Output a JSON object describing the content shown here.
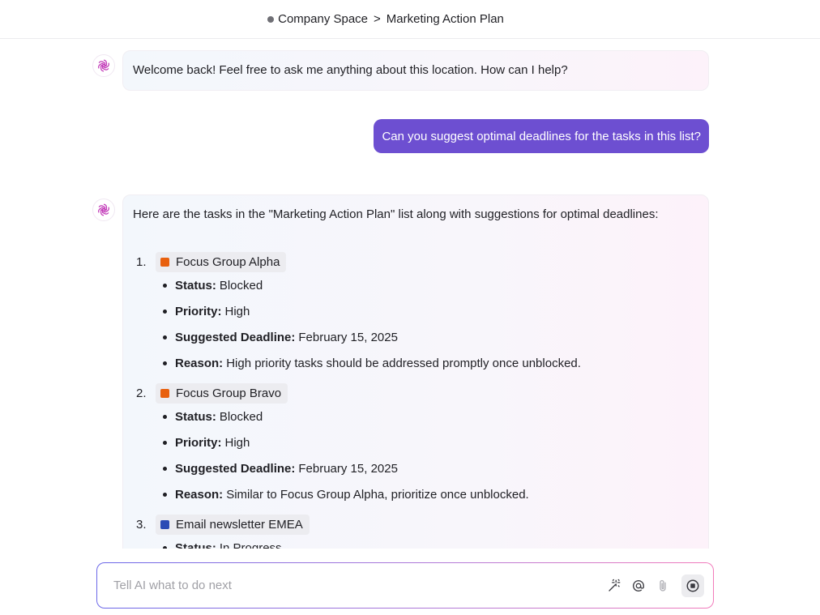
{
  "header": {
    "space": "Company Space",
    "separator": ">",
    "list": "Marketing Action Plan"
  },
  "messages": {
    "welcome": "Welcome back! Feel free to ask me anything about this location. How can I help?",
    "user": "Can you suggest optimal deadlines for the tasks in this list?",
    "answer_intro": "Here are the tasks in the \"Marketing Action Plan\" list along with suggestions for optimal deadlines:"
  },
  "tasks": [
    {
      "number": "1.",
      "name": "Focus Group Alpha",
      "color": "#e8600e",
      "status_label": "Status:",
      "status": "Blocked",
      "priority_label": "Priority:",
      "priority": "High",
      "deadline_label": "Suggested Deadline:",
      "deadline": "February 15, 2025",
      "reason_label": "Reason:",
      "reason": "High priority tasks should be addressed promptly once unblocked."
    },
    {
      "number": "2.",
      "name": "Focus Group Bravo",
      "color": "#e8600e",
      "status_label": "Status:",
      "status": "Blocked",
      "priority_label": "Priority:",
      "priority": "High",
      "deadline_label": "Suggested Deadline:",
      "deadline": "February 15, 2025",
      "reason_label": "Reason:",
      "reason": "Similar to Focus Group Alpha, prioritize once unblocked."
    },
    {
      "number": "3.",
      "name": "Email newsletter EMEA",
      "color": "#2b4bb5",
      "status_label": "Status:",
      "status": "In Progress"
    }
  ],
  "composer": {
    "placeholder": "Tell AI what to do next",
    "icons": [
      "magic-wand-icon",
      "mention-icon",
      "paperclip-icon",
      "stop-icon"
    ]
  },
  "colors": {
    "user_bubble": "#6d4fd1",
    "ai_logo": "#c23ab8"
  }
}
